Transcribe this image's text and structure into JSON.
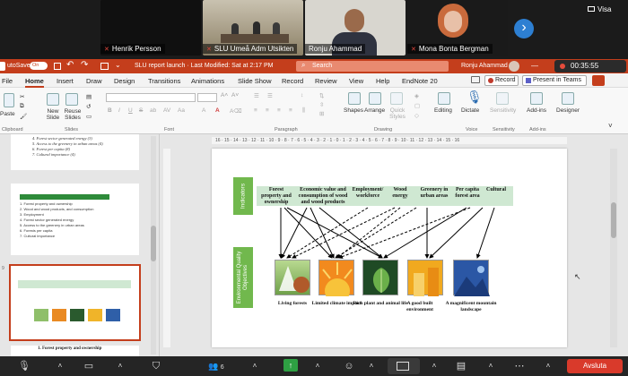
{
  "meeting": {
    "participants": [
      {
        "name": "Henrik Persson",
        "muted": true
      },
      {
        "name": "SLU Umeå Adm Utsikten",
        "muted": true
      },
      {
        "name": "Ronju Ahammad",
        "muted": false
      },
      {
        "name": "Mona Bonta Bergman",
        "muted": true
      }
    ],
    "visa_label": "Visa",
    "next_arrow": "›",
    "timer": "00:35:55",
    "people_count": "6",
    "leave_label": "Avsluta"
  },
  "ppt": {
    "autosave": "utoSave",
    "autosave_state": "On",
    "doc_title": "SLU report launch  ·  Last Modified: Sat at 2:17 PM",
    "search_placeholder": "Search",
    "user_name": "Ronju Ahammad",
    "tabs": [
      "File",
      "Home",
      "Insert",
      "Draw",
      "Design",
      "Transitions",
      "Animations",
      "Slide Show",
      "Record",
      "Review",
      "View",
      "Help",
      "EndNote 20"
    ],
    "active_tab": "Home",
    "record_btn": "Record",
    "present_btn": "Present in Teams",
    "ribbon_buttons": {
      "paste": "Paste",
      "new_slide": "New Slide",
      "reuse_slides": "Reuse Slides",
      "shapes": "Shapes",
      "arrange": "Arrange",
      "quick_styles": "Quick Styles",
      "editing": "Editing",
      "dictate": "Dictate",
      "sensitivity": "Sensitivity",
      "addins": "Add-ins",
      "designer": "Designer"
    },
    "groups": [
      "Clipboard",
      "Slides",
      "Font",
      "Paragraph",
      "Drawing",
      "Voice",
      "Sensitivity",
      "Add-ins"
    ]
  },
  "thumbs": {
    "top_items": [
      "4. Forest sector generated energy (3)",
      "5. Access to the greenery in urban areas (4)",
      "6. Forest per capita (8)",
      "7. Cultural importance (4)"
    ],
    "list_items": [
      "1. Forest property and ownership",
      "2. Wood and wood products, and consumption",
      "3. Employment",
      "4. Forest sector generated energy",
      "5. Access to the greenery in urban areas",
      "6. Forests per capita",
      "7. Cultural importance"
    ],
    "bottom_caption": "1. Forest property and ownership"
  },
  "slide": {
    "indicators_label": "Indicators",
    "objectives_label": "Environmental Quality Objectives",
    "indicators": [
      "Forest property and ownership",
      "Economic value and consumption of wood and wood products",
      "Employment/ workforce",
      "Wood energy",
      "Greenery in urban areas",
      "Per capita forest area",
      "Cultural"
    ],
    "objectives": [
      "Living forests",
      "Limited climate impact",
      "Rich plant and animal life",
      "A good built environment",
      "A magnificent mountain landscape"
    ]
  },
  "ruler": "16 · 15 · 14 · 13 · 12 · 11 · 10 · 9 · 8 · 7 · 6 · 5 · 4 · 3 · 2 · 1 · 0 · 1 · 2 · 3 · 4 · 5 · 6 · 7 · 8 · 9 · 10 · 11 · 12 · 13 · 14 · 15 · 16"
}
